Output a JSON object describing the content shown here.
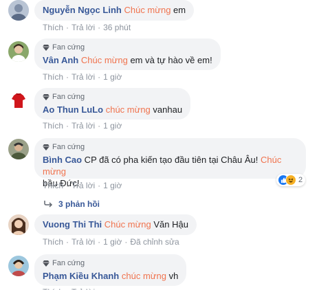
{
  "labels": {
    "like": "Thích",
    "reply": "Trả lời",
    "dot": "·",
    "fan_badge": "Fan cứng",
    "edited": "Đã chỉnh sửa"
  },
  "comments": [
    {
      "author": "Nguyễn Ngọc Linh",
      "pre": "",
      "highlight": "Chúc mừng",
      "post": " em",
      "time": "36 phút"
    },
    {
      "author": "Vân Anh",
      "pre": "",
      "highlight": "Chúc mừng",
      "post": " em và tự hào về em!",
      "time": "1 giờ"
    },
    {
      "author": "Ao Thun LuLo",
      "pre": "",
      "highlight": "chúc mừng",
      "post": " vanhau",
      "time": "1 giờ"
    },
    {
      "author": "Bình Cao",
      "pre": " CP đã có pha kiến tạo đầu tiên tại Châu Âu! ",
      "highlight": "Chúc mừng",
      "line2": "bầu Đức!",
      "time": "1 giờ",
      "reaction_count": "2",
      "replies_label": "3 phản hồi"
    },
    {
      "author": "Vuong Thi Thi",
      "pre": "",
      "highlight": "Chúc mừng",
      "post": " Văn Hậu",
      "time": "1 giờ"
    },
    {
      "author": "Phạm Kiều Khanh",
      "pre": "",
      "highlight": "chúc mừng",
      "post": " vh",
      "time": ""
    }
  ],
  "colors": {
    "author": "#385898",
    "highlight": "#f0734e",
    "bubble": "#f2f3f5",
    "meta": "#90949c"
  },
  "icons": {
    "fan_badge": "diamond-icon",
    "reply_arrow": "reply-arrow-icon",
    "reactions": [
      "like-reaction-icon",
      "haha-reaction-icon"
    ]
  }
}
